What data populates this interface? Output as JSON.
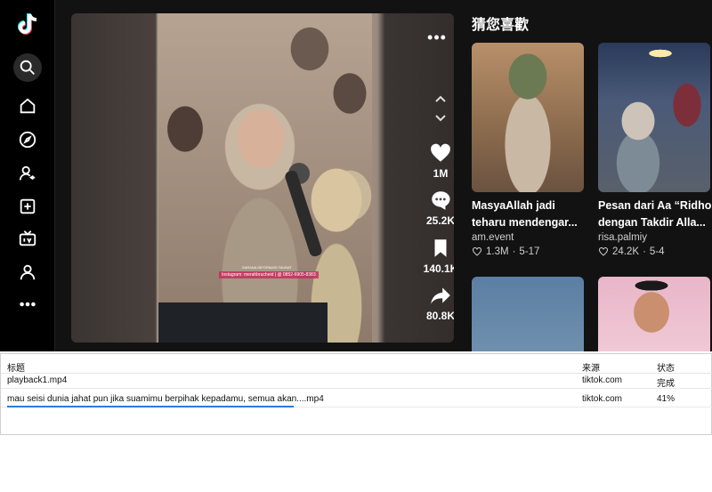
{
  "sidebar": {
    "items": [
      {
        "icon": "search-icon"
      },
      {
        "icon": "home-icon"
      },
      {
        "icon": "compass-icon"
      },
      {
        "icon": "following-icon"
      },
      {
        "icon": "upload-icon"
      },
      {
        "icon": "live-icon"
      },
      {
        "icon": "profile-icon"
      },
      {
        "icon": "more-icon"
      }
    ]
  },
  "video": {
    "watermark": "Instagram: merahbrucheid | @ 0852-6905-8383",
    "watermark_top": "SARANA INFORMASI TAUBAT",
    "actions": {
      "likes": "1M",
      "comments": "25.2K",
      "saves": "140.1K",
      "shares": "80.8K"
    }
  },
  "recommendations": {
    "title": "猜您喜歡",
    "cards": [
      {
        "title_line1": "MasyaAllah jadi",
        "title_line2": "teharu mendengar...",
        "author": "am.event",
        "likes": "1.3M",
        "date": "5-17"
      },
      {
        "title_line1": "Pesan dari Aa “Ridho",
        "title_line2": "dengan Takdir Alla...",
        "author": "risa.palmiy",
        "likes": "24.2K",
        "date": "5-4"
      },
      {
        "title_line1": "",
        "title_line2": "",
        "author": "",
        "likes": "",
        "date": ""
      },
      {
        "title_line1": "",
        "title_line2": "",
        "author": "",
        "likes": "",
        "date": ""
      }
    ]
  },
  "downloads": {
    "headers": {
      "title": "标题",
      "source": "来源",
      "status": "状态"
    },
    "rows": [
      {
        "title": "playback1.mp4",
        "source": "tiktok.com",
        "status": "完成"
      },
      {
        "title": "mau seisi dunia jahat pun jika suamimu berpihak kepadamu, semua akan....mp4",
        "source": "tiktok.com",
        "status": "41%",
        "progress": 0.41
      }
    ]
  },
  "colors": {
    "accent": "#2f7bd8",
    "background": "#121212"
  }
}
